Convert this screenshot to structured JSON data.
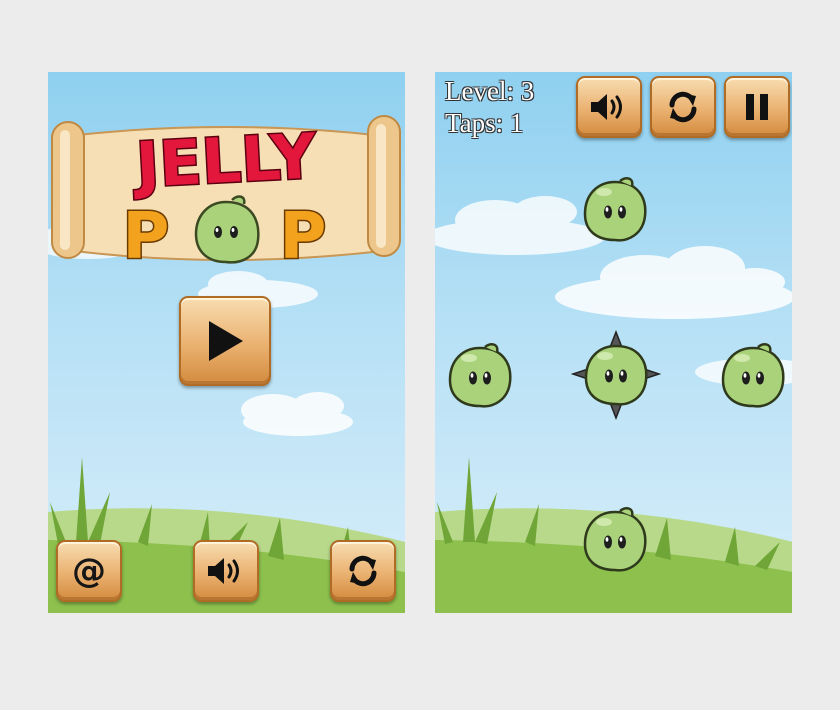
{
  "menu": {
    "logo": {
      "word1": "JELLY",
      "word2_a": "P",
      "word2_b": "P"
    },
    "buttons": {
      "contact_icon": "at-icon",
      "contact_glyph": "@",
      "sound_icon": "speaker-icon",
      "restart_icon": "refresh-icon",
      "play_icon": "play-icon"
    }
  },
  "game": {
    "hud": {
      "level_text": "Level: 3",
      "taps_text": "Taps: 1"
    },
    "buttons": {
      "sound_icon": "speaker-icon",
      "restart_icon": "refresh-icon",
      "pause_icon": "pause-icon"
    },
    "jellies": [
      {
        "name": "jelly-top",
        "spiked": false
      },
      {
        "name": "jelly-left",
        "spiked": false
      },
      {
        "name": "jelly-center",
        "spiked": true
      },
      {
        "name": "jelly-right",
        "spiked": false
      },
      {
        "name": "jelly-bottom",
        "spiked": false
      }
    ]
  },
  "colors": {
    "jelly_green": "#a9d27a",
    "title_red": "#e3163c",
    "pop_orange": "#f2a21c",
    "button_wood": "#eab170",
    "grass": "#8dc04d"
  }
}
